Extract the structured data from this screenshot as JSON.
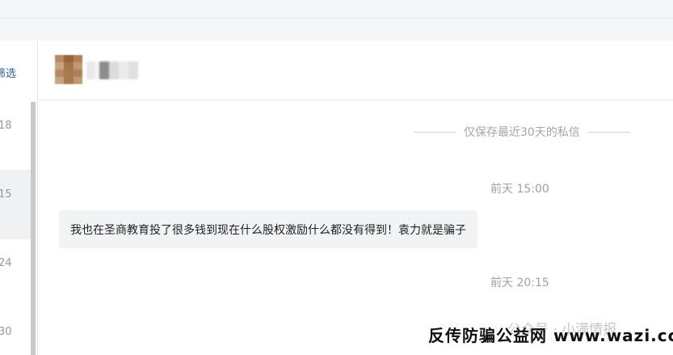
{
  "sidebar": {
    "filter_label": "筛选",
    "conversations": [
      {
        "time": "18"
      },
      {
        "time": "15"
      },
      {
        "time": "24"
      },
      {
        "time": "30"
      }
    ]
  },
  "chat": {
    "notice": "仅保存最近30天的私信",
    "messages": [
      {
        "timestamp": "前天 15:00",
        "text": "我也在圣商教育投了很多钱到现在什么股权激励什么都没有得到！袁力就是骗子"
      },
      {
        "timestamp": "前天 20:15"
      }
    ]
  },
  "watermark": {
    "text": "反传防骗公益网 www.wazi.cc",
    "ghost": "公众号 · 小满情报"
  },
  "colors": {
    "link": "#2d5d9a",
    "muted": "#9ea2a7",
    "bubble_bg": "#f2f3f5"
  }
}
